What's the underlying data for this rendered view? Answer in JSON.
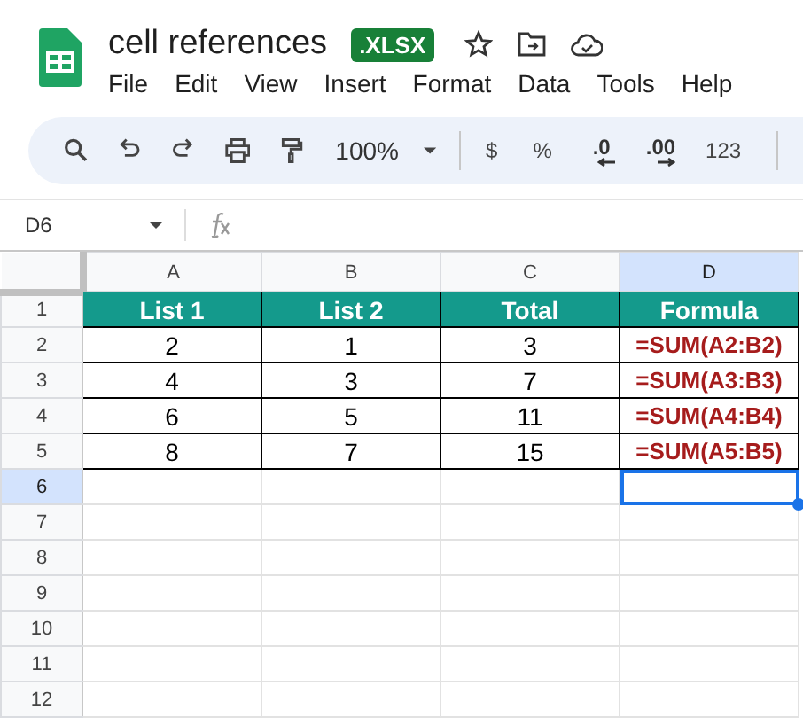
{
  "document": {
    "title": "cell references",
    "badge": ".XLSX"
  },
  "menu": [
    "File",
    "Edit",
    "View",
    "Insert",
    "Format",
    "Data",
    "Tools",
    "Help"
  ],
  "toolbar": [
    {
      "kind": "search"
    },
    {
      "kind": "undo"
    },
    {
      "kind": "redo"
    },
    {
      "kind": "print"
    },
    {
      "kind": "paint"
    },
    {
      "kind": "zoom",
      "text": "100%"
    },
    {
      "kind": "divider"
    },
    {
      "kind": "text",
      "text": "$"
    },
    {
      "kind": "text",
      "text": "%"
    },
    {
      "kind": "decrease",
      "text": ".0"
    },
    {
      "kind": "increase",
      "text": ".00"
    },
    {
      "kind": "text",
      "text": "123"
    },
    {
      "kind": "divider"
    }
  ],
  "name_box": "D6",
  "columns": [
    {
      "label": "A",
      "selected": false
    },
    {
      "label": "B",
      "selected": false
    },
    {
      "label": "C",
      "selected": false
    },
    {
      "label": "D",
      "selected": true
    }
  ],
  "rows": [
    {
      "label": "1",
      "selected": false,
      "cells": [
        {
          "kind": "header",
          "text": "List 1",
          "selected": false
        },
        {
          "kind": "header",
          "text": "List 2",
          "selected": false
        },
        {
          "kind": "header",
          "text": "Total",
          "selected": false
        },
        {
          "kind": "header",
          "text": "Formula",
          "selected": false
        }
      ]
    },
    {
      "label": "2",
      "selected": false,
      "cells": [
        {
          "kind": "number",
          "text": "2",
          "selected": false
        },
        {
          "kind": "number",
          "text": "1",
          "selected": false
        },
        {
          "kind": "number",
          "text": "3",
          "selected": false
        },
        {
          "kind": "formula",
          "text": "=SUM(A2:B2)",
          "selected": false
        }
      ]
    },
    {
      "label": "3",
      "selected": false,
      "cells": [
        {
          "kind": "number",
          "text": "4",
          "selected": false
        },
        {
          "kind": "number",
          "text": "3",
          "selected": false
        },
        {
          "kind": "number",
          "text": "7",
          "selected": false
        },
        {
          "kind": "formula",
          "text": "=SUM(A3:B3)",
          "selected": false
        }
      ]
    },
    {
      "label": "4",
      "selected": false,
      "cells": [
        {
          "kind": "number",
          "text": "6",
          "selected": false
        },
        {
          "kind": "number",
          "text": "5",
          "selected": false
        },
        {
          "kind": "number",
          "text": "11",
          "selected": false
        },
        {
          "kind": "formula",
          "text": "=SUM(A4:B4)",
          "selected": false
        }
      ]
    },
    {
      "label": "5",
      "selected": false,
      "cells": [
        {
          "kind": "number",
          "text": "8",
          "selected": false
        },
        {
          "kind": "number",
          "text": "7",
          "selected": false
        },
        {
          "kind": "number",
          "text": "15",
          "selected": false
        },
        {
          "kind": "formula",
          "text": "=SUM(A5:B5)",
          "selected": false
        }
      ]
    },
    {
      "label": "6",
      "selected": true,
      "cells": [
        {
          "kind": "empty",
          "selected": false
        },
        {
          "kind": "empty",
          "selected": false
        },
        {
          "kind": "empty",
          "selected": false
        },
        {
          "kind": "empty",
          "selected": true
        }
      ]
    },
    {
      "label": "7",
      "selected": false,
      "cells": [
        {
          "kind": "empty",
          "selected": false
        },
        {
          "kind": "empty",
          "selected": false
        },
        {
          "kind": "empty",
          "selected": false
        },
        {
          "kind": "empty",
          "selected": false
        }
      ]
    },
    {
      "label": "8",
      "selected": false,
      "cells": [
        {
          "kind": "empty",
          "selected": false
        },
        {
          "kind": "empty",
          "selected": false
        },
        {
          "kind": "empty",
          "selected": false
        },
        {
          "kind": "empty",
          "selected": false
        }
      ]
    },
    {
      "label": "9",
      "selected": false,
      "cells": [
        {
          "kind": "empty",
          "selected": false
        },
        {
          "kind": "empty",
          "selected": false
        },
        {
          "kind": "empty",
          "selected": false
        },
        {
          "kind": "empty",
          "selected": false
        }
      ]
    },
    {
      "label": "10",
      "selected": false,
      "cells": [
        {
          "kind": "empty",
          "selected": false
        },
        {
          "kind": "empty",
          "selected": false
        },
        {
          "kind": "empty",
          "selected": false
        },
        {
          "kind": "empty",
          "selected": false
        }
      ]
    },
    {
      "label": "11",
      "selected": false,
      "cells": [
        {
          "kind": "empty",
          "selected": false
        },
        {
          "kind": "empty",
          "selected": false
        },
        {
          "kind": "empty",
          "selected": false
        },
        {
          "kind": "empty",
          "selected": false
        }
      ]
    },
    {
      "label": "12",
      "selected": false,
      "cells": [
        {
          "kind": "empty",
          "selected": false
        },
        {
          "kind": "empty",
          "selected": false
        },
        {
          "kind": "empty",
          "selected": false
        },
        {
          "kind": "empty",
          "selected": false
        }
      ]
    }
  ]
}
